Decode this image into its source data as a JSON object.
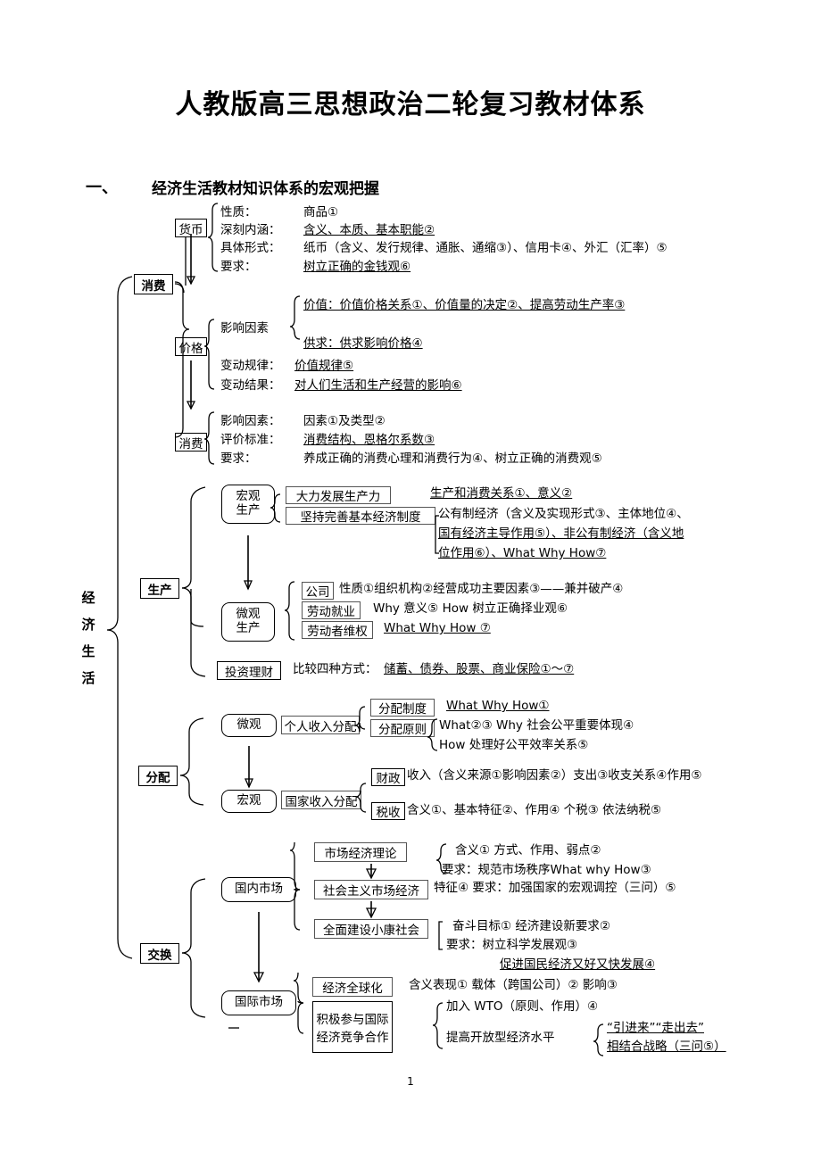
{
  "document": {
    "title": "人教版高三思想政治二轮复习教材体系",
    "section_number": "一、",
    "section_title": "经济生活教材知识体系的宏观把握",
    "page_number": "1"
  },
  "spine": {
    "label_chars": [
      "经",
      "济",
      "生",
      "活"
    ],
    "label": "经济生活"
  },
  "branches": {
    "consumption": "消费",
    "production": "生产",
    "distribution": "分配",
    "exchange": "交换"
  },
  "money": {
    "box": "货币",
    "rows": [
      {
        "key": "性质：",
        "value": "商品①",
        "underline": false
      },
      {
        "key": "深刻内涵：",
        "value": "含义、本质、基本职能②",
        "underline": true
      },
      {
        "key": "具体形式：",
        "value": "纸币（含义、发行规律、通胀、通缩③）、信用卡④、外汇（汇率）⑤",
        "underline": false
      },
      {
        "key": "要求：",
        "value": "树立正确的金钱观⑥",
        "underline": true
      }
    ]
  },
  "price": {
    "box": "价格",
    "factor_label": "影响因素",
    "value_row": "价值：价值价格关系①、价值量的决定②、提高劳动生产率③",
    "supply_row": "供求：供求影响价格④",
    "rows": [
      {
        "key": "变动规律：",
        "value": "价值规律⑤"
      },
      {
        "key": "变动结果：",
        "value": "对人们生活和生产经营的影响⑥"
      }
    ]
  },
  "consumption_detail": {
    "box": "消费",
    "rows": [
      {
        "key": "影响因素：",
        "value": "因素①及类型②"
      },
      {
        "key": "评价标准：",
        "value": "消费结构、恩格尔系数③"
      },
      {
        "key": "要求：",
        "value": "养成正确的消费心理和消费行为④、树立正确的消费观⑤"
      }
    ]
  },
  "macro_production": {
    "tag_line1": "宏观",
    "tag_line2": "生产",
    "item1_box": "大力发展生产力",
    "item1_text": "生产和消费关系①、意义②",
    "item2_box": "坚持完善基本经济制度",
    "item2_lines": [
      "公有制经济（含义及实现形式③、主体地位④、",
      "国有经济主导作用⑤）、非公有制经济（含义地",
      "位作用⑥）、What Why How⑦"
    ]
  },
  "micro_production": {
    "tag_line1": "微观",
    "tag_line2": "生产",
    "rows": [
      {
        "box": "公司",
        "text": "性质①组织机构②经营成功主要因素③——兼并破产④"
      },
      {
        "box": "劳动就业",
        "text": "Why 意义⑤        How 树立正确择业观⑥"
      },
      {
        "box": "劳动者维权",
        "text": "What        Why        How  ⑦"
      }
    ]
  },
  "investment": {
    "box": "投资理财",
    "label": "比较四种方式：",
    "text": "储蓄、债券、股票、商业保险①～⑦"
  },
  "micro_distribution": {
    "tag": "微观",
    "box": "个人收入分配",
    "sub1_box": "分配制度",
    "sub1_text": "What        Why        How①",
    "sub2_box": "分配原则",
    "sub2_line1": "What②③            Why 社会公平重要体现④",
    "sub2_line2": "How 处理好公平效率关系⑤"
  },
  "macro_distribution": {
    "tag": "宏观",
    "box": "国家收入分配",
    "rows": [
      {
        "box": "财政",
        "text": "收入（含义来源①影响因素②）支出③收支关系④作用⑤"
      },
      {
        "box": "税收",
        "text": "含义①、基本特征②、作用④   个税③   依法纳税⑤"
      }
    ]
  },
  "domestic_market": {
    "tag": "国内市场",
    "item1_box": "市场经济理论",
    "item1_line1": "含义①          方式、作用、弱点②",
    "item1_line2": "要求：规范市场秩序What why How③",
    "item2_box": "社会主义市场经济",
    "item2_text": "特征④   要求：加强国家的宏观调控（三问）⑤",
    "item3_box": "全面建设小康社会",
    "item3_line1": "奋斗目标①        经济建设新要求②",
    "item3_line2": "要求：树立科学发展观③",
    "item3_line3": "促进国民经济又好又快发展④"
  },
  "international_market": {
    "tag": "国际市场",
    "item1_box": "经济全球化",
    "item1_text": "含义表现①      载体（跨国公司）②      影响③",
    "item2_box_line1": "积极参与国际",
    "item2_box_line2": "经济竞争合作",
    "item2_line1": "加入 WTO（原则、作用）④",
    "item2_line2_label": "提高开放型经济水平",
    "item2_line2a": "“引进来”“走出去”",
    "item2_line2b": "相结合战略（三问⑤）"
  }
}
